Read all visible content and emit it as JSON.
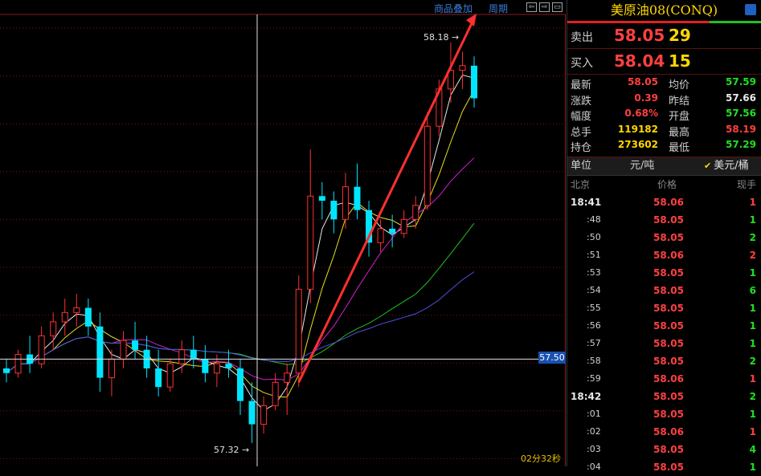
{
  "chart_toolbar": {
    "overlay_label": "商品叠加",
    "period_label": "周期"
  },
  "chart": {
    "current_price_tag": "57.50",
    "high_annotation": "58.18",
    "low_annotation": "57.32",
    "countdown": "02分32秒"
  },
  "chart_data": {
    "type": "candlestick",
    "last_price_line": 57.5,
    "high_marker": 58.18,
    "low_marker": 57.32,
    "candles": [
      {
        "o": 57.48,
        "h": 57.5,
        "l": 57.45,
        "c": 57.47
      },
      {
        "o": 57.47,
        "h": 57.52,
        "l": 57.46,
        "c": 57.51
      },
      {
        "o": 57.51,
        "h": 57.55,
        "l": 57.47,
        "c": 57.49
      },
      {
        "o": 57.49,
        "h": 57.57,
        "l": 57.48,
        "c": 57.55
      },
      {
        "o": 57.55,
        "h": 57.6,
        "l": 57.52,
        "c": 57.58
      },
      {
        "o": 57.58,
        "h": 57.63,
        "l": 57.55,
        "c": 57.6
      },
      {
        "o": 57.6,
        "h": 57.64,
        "l": 57.57,
        "c": 57.61
      },
      {
        "o": 57.61,
        "h": 57.63,
        "l": 57.55,
        "c": 57.57
      },
      {
        "o": 57.57,
        "h": 57.6,
        "l": 57.43,
        "c": 57.46
      },
      {
        "o": 57.46,
        "h": 57.52,
        "l": 57.42,
        "c": 57.5
      },
      {
        "o": 57.5,
        "h": 57.56,
        "l": 57.48,
        "c": 57.54
      },
      {
        "o": 57.54,
        "h": 57.58,
        "l": 57.5,
        "c": 57.52
      },
      {
        "o": 57.52,
        "h": 57.55,
        "l": 57.46,
        "c": 57.48
      },
      {
        "o": 57.48,
        "h": 57.52,
        "l": 57.42,
        "c": 57.44
      },
      {
        "o": 57.44,
        "h": 57.5,
        "l": 57.43,
        "c": 57.49
      },
      {
        "o": 57.49,
        "h": 57.54,
        "l": 57.47,
        "c": 57.52
      },
      {
        "o": 57.52,
        "h": 57.55,
        "l": 57.48,
        "c": 57.5
      },
      {
        "o": 57.5,
        "h": 57.53,
        "l": 57.45,
        "c": 57.47
      },
      {
        "o": 57.47,
        "h": 57.51,
        "l": 57.44,
        "c": 57.49
      },
      {
        "o": 57.49,
        "h": 57.52,
        "l": 57.46,
        "c": 57.48
      },
      {
        "o": 57.48,
        "h": 57.5,
        "l": 57.38,
        "c": 57.41
      },
      {
        "o": 57.41,
        "h": 57.45,
        "l": 57.32,
        "c": 57.36
      },
      {
        "o": 57.36,
        "h": 57.42,
        "l": 57.34,
        "c": 57.4
      },
      {
        "o": 57.4,
        "h": 57.47,
        "l": 57.39,
        "c": 57.45
      },
      {
        "o": 57.45,
        "h": 57.49,
        "l": 57.38,
        "c": 57.47
      },
      {
        "o": 57.47,
        "h": 57.68,
        "l": 57.44,
        "c": 57.65
      },
      {
        "o": 57.65,
        "h": 57.95,
        "l": 57.62,
        "c": 57.85
      },
      {
        "o": 57.85,
        "h": 57.88,
        "l": 57.8,
        "c": 57.84
      },
      {
        "o": 57.84,
        "h": 57.86,
        "l": 57.77,
        "c": 57.8
      },
      {
        "o": 57.8,
        "h": 57.9,
        "l": 57.78,
        "c": 57.87
      },
      {
        "o": 57.87,
        "h": 57.92,
        "l": 57.8,
        "c": 57.82
      },
      {
        "o": 57.82,
        "h": 57.84,
        "l": 57.72,
        "c": 57.75
      },
      {
        "o": 57.75,
        "h": 57.8,
        "l": 57.73,
        "c": 57.78
      },
      {
        "o": 57.78,
        "h": 57.81,
        "l": 57.74,
        "c": 57.77
      },
      {
        "o": 57.77,
        "h": 57.82,
        "l": 57.76,
        "c": 57.8
      },
      {
        "o": 57.8,
        "h": 57.85,
        "l": 57.78,
        "c": 57.83
      },
      {
        "o": 57.83,
        "h": 58.03,
        "l": 57.82,
        "c": 58.0
      },
      {
        "o": 58.0,
        "h": 58.1,
        "l": 57.98,
        "c": 58.08
      },
      {
        "o": 58.08,
        "h": 58.18,
        "l": 58.05,
        "c": 58.12
      },
      {
        "o": 58.12,
        "h": 58.16,
        "l": 58.08,
        "c": 58.13
      },
      {
        "o": 58.13,
        "h": 58.15,
        "l": 58.04,
        "c": 58.06
      }
    ]
  },
  "panel": {
    "title": "美原油08(CONQ)",
    "sell_label": "卖出",
    "sell_price": "58.05",
    "sell_vol": "29",
    "buy_label": "买入",
    "buy_price": "58.04",
    "buy_vol": "15",
    "stats": [
      {
        "a": "最新",
        "av": "58.05",
        "avc": "#ff4040",
        "b": "均价",
        "bv": "57.59",
        "bvc": "#20e020"
      },
      {
        "a": "涨跌",
        "av": "0.39",
        "avc": "#ff4040",
        "b": "昨结",
        "bv": "57.66",
        "bvc": "#e8e8e8"
      },
      {
        "a": "幅度",
        "av": "0.68%",
        "avc": "#ff4040",
        "b": "开盘",
        "bv": "57.56",
        "bvc": "#20e020"
      },
      {
        "a": "总手",
        "av": "119182",
        "avc": "#ffd700",
        "b": "最高",
        "bv": "58.19",
        "bvc": "#ff4040"
      },
      {
        "a": "持仓",
        "av": "273602",
        "avc": "#ffd700",
        "b": "最低",
        "bv": "57.29",
        "bvc": "#20e020"
      }
    ],
    "unit_label": "单位",
    "unit_opt1": "元/吨",
    "unit_opt2": "美元/桶",
    "unit_check": "✔",
    "col_time": "北京",
    "col_price": "价格",
    "col_qty": "现手",
    "ticks": [
      {
        "t": "18:41",
        "full": true,
        "p": "58.06",
        "q": "1",
        "qc": "#ff4040"
      },
      {
        "t": ":48",
        "full": false,
        "p": "58.05",
        "q": "1",
        "qc": "#20e020"
      },
      {
        "t": ":50",
        "full": false,
        "p": "58.05",
        "q": "2",
        "qc": "#20e020"
      },
      {
        "t": ":51",
        "full": false,
        "p": "58.06",
        "q": "2",
        "qc": "#ff4040"
      },
      {
        "t": ":53",
        "full": false,
        "p": "58.05",
        "q": "1",
        "qc": "#20e020"
      },
      {
        "t": ":54",
        "full": false,
        "p": "58.05",
        "q": "6",
        "qc": "#20e020"
      },
      {
        "t": ":55",
        "full": false,
        "p": "58.05",
        "q": "1",
        "qc": "#20e020"
      },
      {
        "t": ":56",
        "full": false,
        "p": "58.05",
        "q": "1",
        "qc": "#20e020"
      },
      {
        "t": ":57",
        "full": false,
        "p": "58.05",
        "q": "1",
        "qc": "#20e020"
      },
      {
        "t": ":58",
        "full": false,
        "p": "58.05",
        "q": "2",
        "qc": "#20e020"
      },
      {
        "t": ":59",
        "full": false,
        "p": "58.06",
        "q": "1",
        "qc": "#ff4040"
      },
      {
        "t": "18:42",
        "full": true,
        "p": "58.05",
        "q": "2",
        "qc": "#20e020"
      },
      {
        "t": ":01",
        "full": false,
        "p": "58.05",
        "q": "1",
        "qc": "#20e020"
      },
      {
        "t": ":02",
        "full": false,
        "p": "58.06",
        "q": "1",
        "qc": "#ff4040"
      },
      {
        "t": ":03",
        "full": false,
        "p": "58.05",
        "q": "4",
        "qc": "#20e020"
      },
      {
        "t": ":04",
        "full": false,
        "p": "58.05",
        "q": "1",
        "qc": "#20e020"
      }
    ]
  }
}
